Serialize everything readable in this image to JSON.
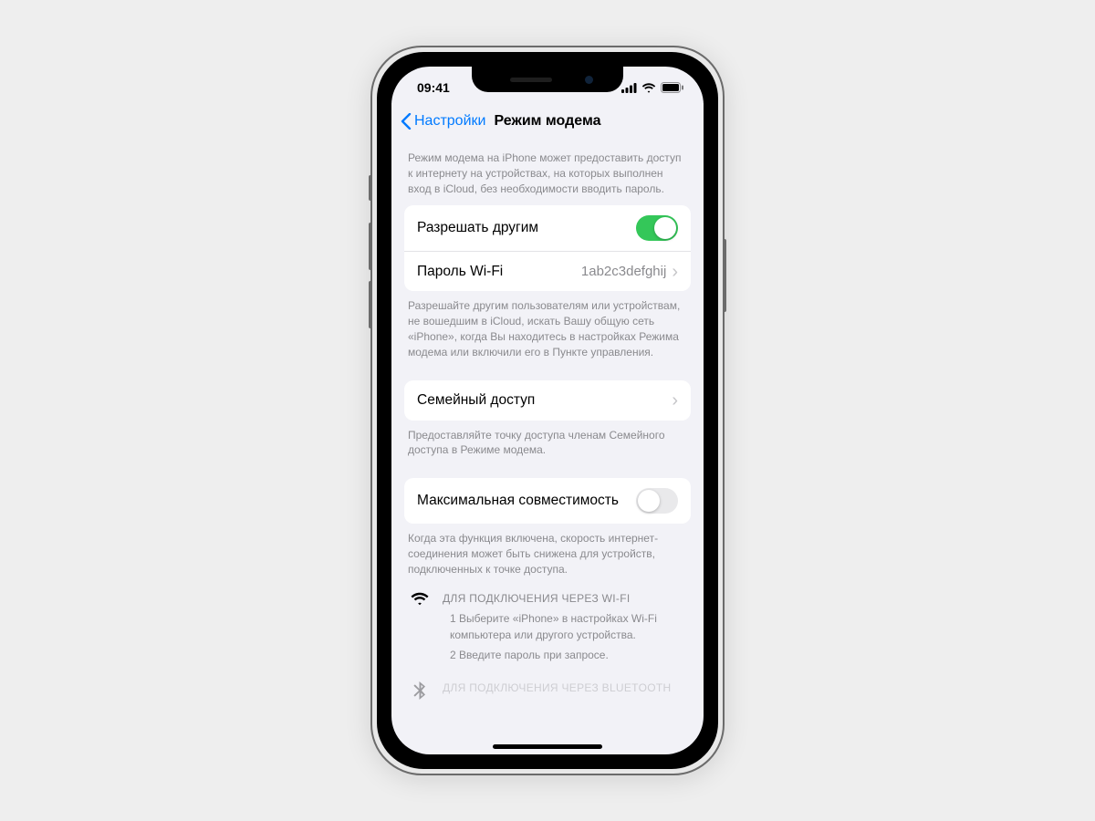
{
  "status": {
    "time": "09:41"
  },
  "nav": {
    "back": "Настройки",
    "title": "Режим модема"
  },
  "intro": "Режим модема на iPhone может предоставить доступ к интернету на устройствах, на которых выполнен вход в iCloud, без необходимости вводить пароль.",
  "allow": {
    "label": "Разрешать другим",
    "on": true,
    "footer": "Разрешайте другим пользователям или устройствам, не вошедшим в iCloud, искать Вашу общую сеть «iPhone», когда Вы находитесь в настройках Режима модема или включили его в Пункте управления."
  },
  "wifi": {
    "label": "Пароль Wi-Fi",
    "value": "1ab2c3defghij"
  },
  "family": {
    "label": "Семейный доступ",
    "footer": "Предоставляйте точку доступа членам Семейного доступа в Режиме модема."
  },
  "compat": {
    "label": "Максимальная совместимость",
    "on": false,
    "footer": "Когда эта функция включена, скорость интернет-соединения может быть снижена для устройств, подключенных к точке доступа."
  },
  "instr_wifi": {
    "heading": "ДЛЯ ПОДКЛЮЧЕНИЯ ЧЕРЕЗ WI-FI",
    "step1": "1 Выберите «iPhone» в настройках Wi-Fi компьютера или другого устройства.",
    "step2": "2 Введите пароль при запросе."
  },
  "instr_bt": {
    "heading": "ДЛЯ ПОДКЛЮЧЕНИЯ ЧЕРЕЗ BLUETOOTH"
  }
}
